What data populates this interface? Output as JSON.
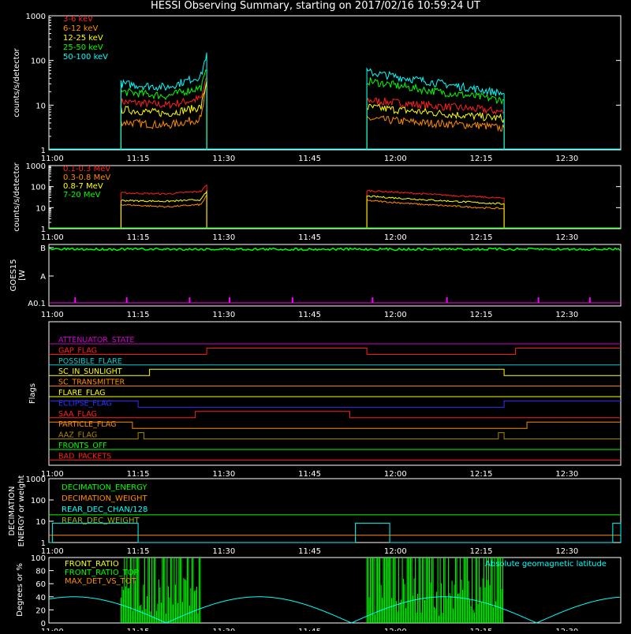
{
  "title": "HESSI Observing Summary, starting on 2017/02/16 10:59:24 UT",
  "x_ticks": [
    "11:00",
    "11:15",
    "11:30",
    "11:45",
    "12:00",
    "12:15",
    "12:30"
  ],
  "chart_data": [
    {
      "type": "line",
      "name_id": "panel1",
      "ylabel": "counts/s/detector",
      "yscale": "log",
      "ylim": [
        1,
        1000
      ],
      "y_ticks": [
        "1",
        "10",
        "100",
        "1000"
      ],
      "xlim": [
        "10:59:24",
        "12:39:24"
      ],
      "series": [
        {
          "name": "3-6 keV",
          "color": "#ff2020",
          "segments": [
            {
              "x": [
                "11:12",
                "11:20",
                "11:26",
                "11:27"
              ],
              "y": [
                12,
                10,
                14,
                40
              ]
            },
            {
              "x": [
                "11:55",
                "12:05",
                "12:15",
                "12:19"
              ],
              "y": [
                13,
                10,
                8,
                7
              ]
            }
          ]
        },
        {
          "name": "6-12 keV",
          "color": "#ff8c00",
          "segments": [
            {
              "x": [
                "11:12",
                "11:20",
                "11:26",
                "11:27"
              ],
              "y": [
                4.2,
                3.5,
                5,
                30
              ]
            },
            {
              "x": [
                "11:55",
                "12:05",
                "12:15",
                "12:19"
              ],
              "y": [
                5,
                4,
                3.5,
                3
              ]
            }
          ]
        },
        {
          "name": "12-25 keV",
          "color": "#ffff00",
          "segments": [
            {
              "x": [
                "11:12",
                "11:20",
                "11:26",
                "11:27"
              ],
              "y": [
                8,
                6.5,
                9,
                35
              ]
            },
            {
              "x": [
                "11:55",
                "12:05",
                "12:15",
                "12:19"
              ],
              "y": [
                9,
                7,
                5.5,
                5
              ]
            }
          ]
        },
        {
          "name": "25-50 keV",
          "color": "#00ff00",
          "segments": [
            {
              "x": [
                "11:12",
                "11:20",
                "11:26",
                "11:27"
              ],
              "y": [
                20,
                16,
                25,
                60
              ]
            },
            {
              "x": [
                "11:55",
                "12:05",
                "12:15",
                "12:19"
              ],
              "y": [
                35,
                22,
                15,
                13
              ]
            }
          ]
        },
        {
          "name": "50-100 keV",
          "color": "#00ffff",
          "segments": [
            {
              "x": [
                "11:12",
                "11:20",
                "11:26",
                "11:27"
              ],
              "y": [
                30,
                25,
                45,
                150
              ]
            },
            {
              "x": [
                "11:55",
                "12:05",
                "12:15",
                "12:19"
              ],
              "y": [
                55,
                35,
                22,
                18
              ]
            }
          ]
        }
      ]
    },
    {
      "type": "line",
      "name_id": "panel2",
      "ylabel": "counts/s/detector",
      "yscale": "log",
      "ylim": [
        1,
        1000
      ],
      "y_ticks": [
        "1",
        "10",
        "100",
        "1000"
      ],
      "series": [
        {
          "name": "0.1-0.3 MeV",
          "color": "#ff2020",
          "segments": [
            {
              "x": [
                "11:12",
                "11:20",
                "11:26",
                "11:27"
              ],
              "y": [
                50,
                45,
                60,
                120
              ]
            },
            {
              "x": [
                "11:55",
                "12:05",
                "12:15",
                "12:19"
              ],
              "y": [
                65,
                45,
                32,
                28
              ]
            }
          ]
        },
        {
          "name": "0.3-0.8 MeV",
          "color": "#ff8c00",
          "segments": [
            {
              "x": [
                "11:12",
                "11:20",
                "11:26",
                "11:27"
              ],
              "y": [
                14,
                11,
                14,
                40
              ]
            },
            {
              "x": [
                "11:55",
                "12:05",
                "12:15",
                "12:19"
              ],
              "y": [
                22,
                14,
                10,
                9
              ]
            }
          ]
        },
        {
          "name": "0.8-7 MeV",
          "color": "#ffff00",
          "segments": [
            {
              "x": [
                "11:12",
                "11:20",
                "11:26",
                "11:27"
              ],
              "y": [
                22,
                20,
                24,
                60
              ]
            },
            {
              "x": [
                "11:55",
                "12:05",
                "12:15",
                "12:19"
              ],
              "y": [
                35,
                24,
                17,
                15
              ]
            }
          ]
        },
        {
          "name": "7-20 MeV",
          "color": "#00ff00",
          "segments": [
            {
              "x": [
                "10:59:24",
                "12:39:24"
              ],
              "y": [
                1,
                1
              ]
            }
          ]
        }
      ]
    },
    {
      "type": "line",
      "name_id": "goes",
      "ylabel": "GOES15 [W m^-2]",
      "y_ticks": [
        "A0.1",
        "A",
        "B"
      ],
      "series": [
        {
          "name": "GOES low",
          "color": "#00ff00",
          "level": "B"
        },
        {
          "name": "ticks",
          "color": "#ff00ff",
          "x": [
            "11:04",
            "11:13",
            "11:24",
            "11:31",
            "11:42",
            "11:56",
            "12:09",
            "12:25",
            "12:34"
          ]
        }
      ]
    },
    {
      "type": "line",
      "name_id": "flags",
      "ylabel": "Flags",
      "flags": [
        {
          "name": "ATTENUATOR_STATE",
          "color": "#cc00cc",
          "steps": []
        },
        {
          "name": "GAP_FLAG",
          "color": "#ff2020",
          "steps": [
            [
              "10:59:24",
              0
            ],
            [
              "11:27",
              1
            ],
            [
              "11:55",
              0
            ],
            [
              "12:21",
              1
            ]
          ]
        },
        {
          "name": "POSSIBLE_FLARE",
          "color": "#00cccc",
          "steps": []
        },
        {
          "name": "SC_IN_SUNLIGHT",
          "color": "#ffff00",
          "steps": [
            [
              "10:59:24",
              0
            ],
            [
              "11:17",
              1
            ],
            [
              "12:19",
              0
            ]
          ]
        },
        {
          "name": "SC_TRANSMITTER",
          "color": "#ff8c00",
          "steps": []
        },
        {
          "name": "FLARE_FLAG",
          "color": "#ffff00",
          "steps": []
        },
        {
          "name": "ECLIPSE_FLAG",
          "color": "#3030ff",
          "steps": [
            [
              "10:59:24",
              1
            ],
            [
              "11:15",
              0
            ],
            [
              "12:19",
              1
            ]
          ]
        },
        {
          "name": "SAA_FLAG",
          "color": "#ff2020",
          "steps": [
            [
              "10:59:24",
              0
            ],
            [
              "11:25",
              1
            ],
            [
              "11:52",
              0
            ]
          ]
        },
        {
          "name": "PARTICLE_FLAG",
          "color": "#ff8c00",
          "steps": [
            [
              "10:59:24",
              1
            ],
            [
              "11:14",
              0
            ],
            [
              "12:23",
              1
            ]
          ]
        },
        {
          "name": "AAZ_FLAG",
          "color": "#aa8800",
          "steps": [
            [
              "10:59:24",
              0
            ],
            [
              "11:15",
              1
            ],
            [
              "11:16",
              0
            ],
            [
              "12:18",
              1
            ],
            [
              "12:19",
              0
            ]
          ]
        },
        {
          "name": "FRONTS_OFF",
          "color": "#00ff00",
          "steps": []
        },
        {
          "name": "BAD_PACKETS",
          "color": "#ff2020",
          "steps": []
        }
      ]
    },
    {
      "type": "line",
      "name_id": "decim",
      "ylabel": "DECIMATION ENERGY or weight",
      "yscale": "log",
      "ylim": [
        1,
        1000
      ],
      "y_ticks": [
        "1",
        "10",
        "100",
        "1000"
      ],
      "series": [
        {
          "name": "DECIMATION_ENERGY",
          "color": "#00ff00",
          "value": "constant"
        },
        {
          "name": "DECIMATION_WEIGHT",
          "color": "#ff8c00",
          "value": "constant"
        },
        {
          "name": "REAR_DEC_CHAN/128",
          "color": "#00ffff",
          "value": "pulses"
        },
        {
          "name": "REAR_DEC_WEIGHT",
          "color": "#aaaa00",
          "value": "constant"
        }
      ]
    },
    {
      "type": "line",
      "name_id": "ratio",
      "ylabel": "Degrees or %",
      "ylim": [
        0,
        100
      ],
      "y_ticks": [
        "0",
        "20",
        "40",
        "60",
        "80",
        "100"
      ],
      "series": [
        {
          "name": "FRONT_RATIO",
          "color": "#ffff00"
        },
        {
          "name": "FRONT_RATIO_TOP",
          "color": "#00ff00"
        },
        {
          "name": "MAX_DET_VS_TOT",
          "color": "#ff8c00"
        },
        {
          "name": "Absolute geomagnetic latitude",
          "color": "#00ffff"
        }
      ]
    }
  ]
}
